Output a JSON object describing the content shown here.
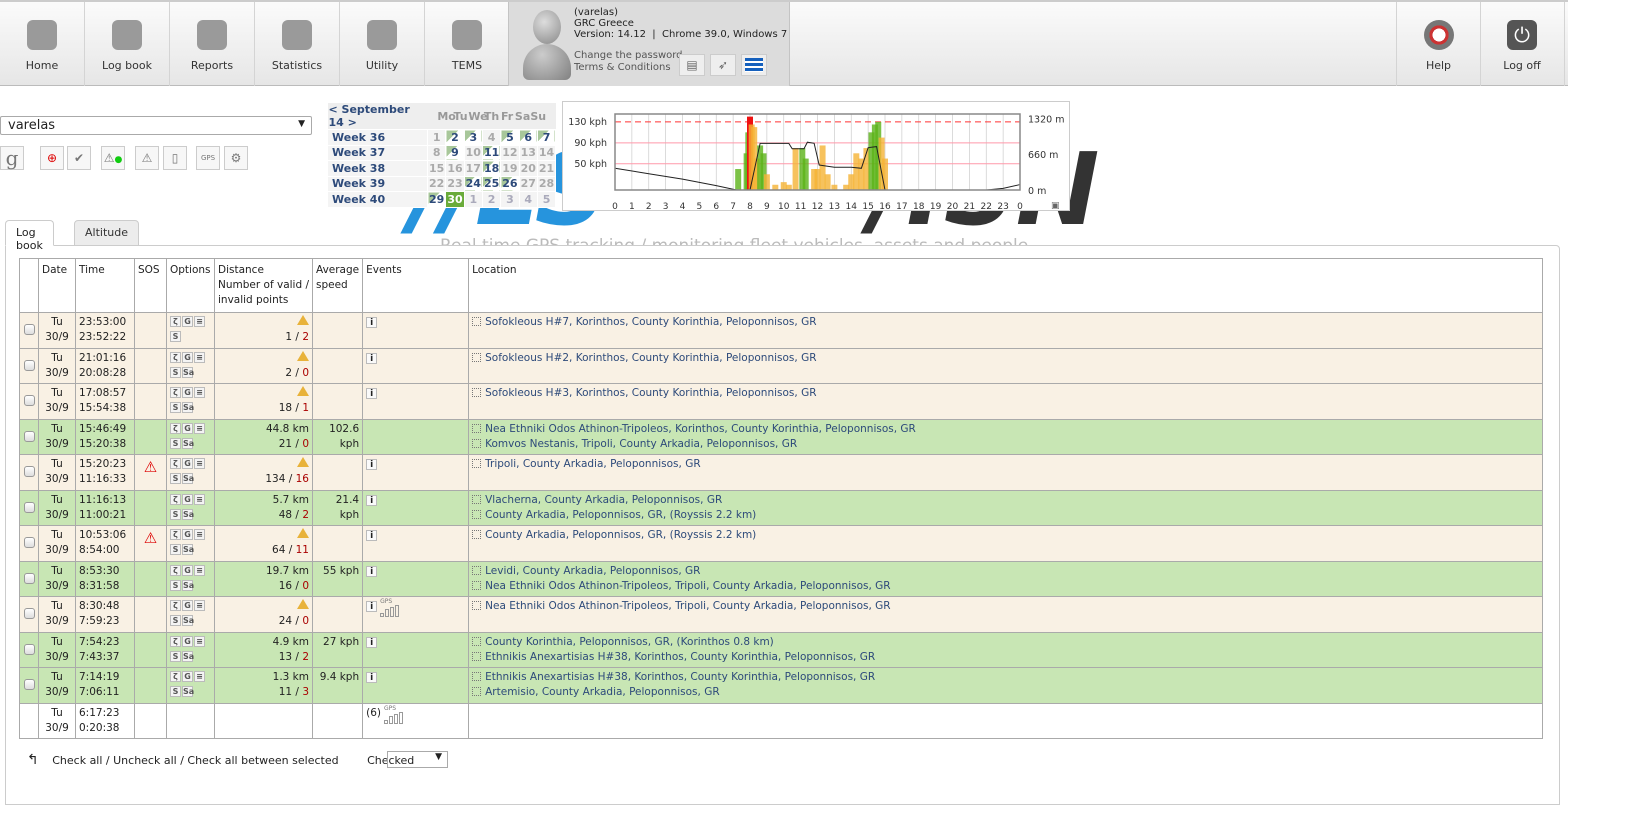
{
  "nav": {
    "items": [
      {
        "label": "Home",
        "icon": "home-icon"
      },
      {
        "label": "Log book",
        "icon": "calendar-icon"
      },
      {
        "label": "Reports",
        "icon": "reports-icon"
      },
      {
        "label": "Statistics",
        "icon": "pie-chart-icon"
      },
      {
        "label": "Utility",
        "icon": "gears-icon"
      },
      {
        "label": "TEMS",
        "icon": "globe-icon"
      }
    ],
    "help": "Help",
    "logoff": "Log off"
  },
  "user": {
    "login": "(varelas)",
    "company": "GRC Greece",
    "version": "Version: 14.12  |  Chrome 39.0, Windows 7",
    "change_password": "Change the password",
    "terms": "Terms & Conditions"
  },
  "vehicle_select": {
    "value": "varelas"
  },
  "calendar": {
    "month": "< September 14 >",
    "days": [
      "Mo",
      "Tu",
      "We",
      "Th",
      "Fr",
      "Sa",
      "Su"
    ],
    "weeks": [
      {
        "label": "Week 36",
        "days": [
          {
            "d": "1"
          },
          {
            "d": "2",
            "a": 1
          },
          {
            "d": "3",
            "a": 1
          },
          {
            "d": "4"
          },
          {
            "d": "5",
            "a": 1
          },
          {
            "d": "6",
            "a": 1
          },
          {
            "d": "7",
            "a": 1
          }
        ]
      },
      {
        "label": "Week 37",
        "days": [
          {
            "d": "8"
          },
          {
            "d": "9",
            "a": 1
          },
          {
            "d": "10"
          },
          {
            "d": "11",
            "a": 1
          },
          {
            "d": "12"
          },
          {
            "d": "13"
          },
          {
            "d": "14"
          }
        ]
      },
      {
        "label": "Week 38",
        "days": [
          {
            "d": "15"
          },
          {
            "d": "16"
          },
          {
            "d": "17"
          },
          {
            "d": "18",
            "a": 1
          },
          {
            "d": "19"
          },
          {
            "d": "20"
          },
          {
            "d": "21"
          }
        ]
      },
      {
        "label": "Week 39",
        "days": [
          {
            "d": "22"
          },
          {
            "d": "23"
          },
          {
            "d": "24",
            "a": 1
          },
          {
            "d": "25",
            "a": 1
          },
          {
            "d": "26",
            "a": 1
          },
          {
            "d": "27"
          },
          {
            "d": "28"
          }
        ]
      },
      {
        "label": "Week 40",
        "days": [
          {
            "d": "29",
            "a": 1
          },
          {
            "d": "30",
            "s": 1
          },
          {
            "d": "1",
            "n": 1
          },
          {
            "d": "2",
            "n": 1
          },
          {
            "d": "3",
            "n": 1
          },
          {
            "d": "4",
            "n": 1
          },
          {
            "d": "5",
            "n": 1
          }
        ]
      }
    ]
  },
  "logo_text": "MLS NSN",
  "slogan": "Real time GPS tracking / monitoring fleet vehicles, assets and people",
  "chart_data": {
    "type": "bar",
    "x_label_ticks": [
      "0",
      "1",
      "2",
      "3",
      "4",
      "5",
      "6",
      "7",
      "8",
      "9",
      "10",
      "11",
      "12",
      "13",
      "14",
      "15",
      "16",
      "17",
      "18",
      "19",
      "20",
      "21",
      "22",
      "23",
      "0"
    ],
    "left_ticks": [
      "130 kph",
      "90 kph",
      "50 kph"
    ],
    "right_ticks": [
      "1320 m",
      "660 m",
      "0 m"
    ],
    "speed_limit_kph": 130,
    "colors": {
      "green": "#5bb318",
      "orange": "#f5b335",
      "red": "#ee1111",
      "altitude": "#222222"
    },
    "speed": [
      [
        7.3,
        40,
        "green"
      ],
      [
        7.8,
        70,
        "green"
      ],
      [
        7.9,
        110,
        "green"
      ],
      [
        8.0,
        140,
        "red"
      ],
      [
        8.1,
        125,
        "orange"
      ],
      [
        8.25,
        120,
        "orange"
      ],
      [
        8.4,
        60,
        "orange"
      ],
      [
        8.6,
        85,
        "green"
      ],
      [
        8.8,
        70,
        "green"
      ],
      [
        9.0,
        30,
        "orange"
      ],
      [
        9.5,
        10,
        "orange"
      ],
      [
        10.0,
        15,
        "orange"
      ],
      [
        10.3,
        10,
        "orange"
      ],
      [
        10.7,
        80,
        "orange"
      ],
      [
        11.1,
        80,
        "green"
      ],
      [
        11.3,
        60,
        "green"
      ],
      [
        11.8,
        40,
        "orange"
      ],
      [
        12.0,
        40,
        "orange"
      ],
      [
        12.3,
        85,
        "orange"
      ],
      [
        12.6,
        30,
        "orange"
      ],
      [
        13.0,
        10,
        "orange"
      ],
      [
        13.7,
        10,
        "orange"
      ],
      [
        14.0,
        30,
        "orange"
      ],
      [
        14.3,
        70,
        "orange"
      ],
      [
        14.6,
        60,
        "orange"
      ],
      [
        14.9,
        80,
        "orange"
      ],
      [
        15.2,
        110,
        "green"
      ],
      [
        15.4,
        125,
        "green"
      ],
      [
        15.6,
        130,
        "green"
      ],
      [
        15.8,
        100,
        "orange"
      ],
      [
        16.0,
        60,
        "orange"
      ]
    ],
    "altitude": [
      [
        0,
        400
      ],
      [
        2,
        300
      ],
      [
        4,
        200
      ],
      [
        6,
        80
      ],
      [
        7.2,
        0
      ],
      [
        8,
        0
      ],
      [
        8.6,
        860
      ],
      [
        9,
        860
      ],
      [
        10.3,
        860
      ],
      [
        10.5,
        760
      ],
      [
        11.2,
        760
      ],
      [
        11.4,
        880
      ],
      [
        11.8,
        860
      ],
      [
        12.1,
        460
      ],
      [
        13,
        420
      ],
      [
        14,
        420
      ],
      [
        14.6,
        400
      ],
      [
        15,
        780
      ],
      [
        15.5,
        800
      ],
      [
        16,
        0
      ],
      [
        20,
        0
      ],
      [
        22,
        0
      ],
      [
        23,
        30
      ],
      [
        24,
        100
      ]
    ]
  },
  "tabs": [
    {
      "label": "Log book"
    },
    {
      "label": "Altitude"
    }
  ],
  "table": {
    "headers": {
      "date": "Date",
      "time": "Time",
      "sos": "SOS",
      "options": "Options",
      "distance": "Distance",
      "points": "Number of valid / invalid points",
      "avg": "Average speed",
      "events": "Events",
      "location": "Location"
    },
    "rows": [
      {
        "type": "tan",
        "day": "Tu",
        "date": "30/9",
        "t1": "23:53:00",
        "t2": "23:52:22",
        "sos": "",
        "dist": "",
        "valid": "1",
        "invalid": "2",
        "avg": "",
        "events": "i",
        "loc1": "Sofokleous H#7, Korinthos, County Korinthia, Peloponnisos, GR",
        "loc2": ""
      },
      {
        "type": "tan",
        "day": "Tu",
        "date": "30/9",
        "t1": "21:01:16",
        "t2": "20:08:28",
        "sos": "",
        "dist": "",
        "valid": "2",
        "invalid": "0",
        "avg": "",
        "events": "i",
        "loc1": "Sofokleous H#2, Korinthos, County Korinthia, Peloponnisos, GR",
        "loc2": ""
      },
      {
        "type": "tan",
        "day": "Tu",
        "date": "30/9",
        "t1": "17:08:57",
        "t2": "15:54:38",
        "sos": "",
        "dist": "",
        "valid": "18",
        "invalid": "1",
        "avg": "",
        "events": "i",
        "loc1": "Sofokleous H#3, Korinthos, County Korinthia, Peloponnisos, GR",
        "loc2": ""
      },
      {
        "type": "grn",
        "day": "Tu",
        "date": "30/9",
        "t1": "15:46:49",
        "t2": "15:20:38",
        "sos": "",
        "dist": "44.8 km",
        "valid": "21",
        "invalid": "0",
        "avg": "102.6 kph",
        "events": "",
        "loc1": "Nea Ethniki Odos Athinon-Tripoleos, Korinthos, County Korinthia, Peloponnisos, GR",
        "loc2": "Komvos Nestanis, Tripoli, County Arkadia, Peloponnisos, GR"
      },
      {
        "type": "tan",
        "day": "Tu",
        "date": "30/9",
        "t1": "15:20:23",
        "t2": "11:16:33",
        "sos": "warning",
        "dist": "",
        "valid": "134",
        "invalid": "16",
        "avg": "",
        "events": "i",
        "loc1": "Tripoli, County Arkadia, Peloponnisos, GR",
        "loc2": ""
      },
      {
        "type": "grn",
        "day": "Tu",
        "date": "30/9",
        "t1": "11:16:13",
        "t2": "11:00:21",
        "sos": "",
        "dist": "5.7 km",
        "valid": "48",
        "invalid": "2",
        "avg": "21.4 kph",
        "events": "i",
        "loc1": "Vlacherna, County Arkadia, Peloponnisos, GR",
        "loc2": "County Arkadia, Peloponnisos, GR, (Royssis 2.2 km)"
      },
      {
        "type": "tan",
        "day": "Tu",
        "date": "30/9",
        "t1": "10:53:06",
        "t2": "8:54:00",
        "sos": "warning",
        "dist": "",
        "valid": "64",
        "invalid": "11",
        "avg": "",
        "events": "i",
        "loc1": "County Arkadia, Peloponnisos, GR, (Royssis 2.2 km)",
        "loc2": ""
      },
      {
        "type": "grn",
        "day": "Tu",
        "date": "30/9",
        "t1": "8:53:30",
        "t2": "8:31:58",
        "sos": "",
        "dist": "19.7 km",
        "valid": "16",
        "invalid": "0",
        "avg": "55 kph",
        "events": "i",
        "loc1": "Levidi, County Arkadia, Peloponnisos, GR",
        "loc2": "Nea Ethniki Odos Athinon-Tripoleos, Tripoli, County Arkadia, Peloponnisos, GR"
      },
      {
        "type": "tan",
        "day": "Tu",
        "date": "30/9",
        "t1": "8:30:48",
        "t2": "7:59:23",
        "sos": "",
        "dist": "",
        "valid": "24",
        "invalid": "0",
        "avg": "",
        "events": "i",
        "gps": "GPS",
        "loc1": "Nea Ethniki Odos Athinon-Tripoleos, Tripoli, County Arkadia, Peloponnisos, GR",
        "loc2": ""
      },
      {
        "type": "grn",
        "day": "Tu",
        "date": "30/9",
        "t1": "7:54:23",
        "t2": "7:43:37",
        "sos": "",
        "dist": "4.9 km",
        "valid": "13",
        "invalid": "2",
        "avg": "27 kph",
        "events": "i",
        "loc1": "County Korinthia, Peloponnisos, GR, (Korinthos 0.8 km)",
        "loc2": "Ethnikis Anexartisias H#38, Korinthos, County Korinthia, Peloponnisos, GR"
      },
      {
        "type": "grn",
        "day": "Tu",
        "date": "30/9",
        "t1": "7:14:19",
        "t2": "7:06:11",
        "sos": "",
        "dist": "1.3 km",
        "valid": "11",
        "invalid": "3",
        "avg": "9.4 kph",
        "events": "i",
        "loc1": "Ethnikis Anexartisias H#38, Korinthos, County Korinthia, Peloponnisos, GR",
        "loc2": "Artemisio, County Arkadia, Peloponnisos, GR"
      },
      {
        "type": "wht",
        "day": "Tu",
        "date": "30/9",
        "t1": "6:17:23",
        "t2": "0:20:38",
        "sos": "",
        "dist": "",
        "valid": "",
        "invalid": "",
        "avg": "",
        "events": "(6)",
        "gps": "GPS",
        "loc1": "",
        "loc2": ""
      }
    ]
  },
  "footer": {
    "check_all": "Check all / Uncheck all / Check all between selected",
    "checked": "Checked"
  }
}
